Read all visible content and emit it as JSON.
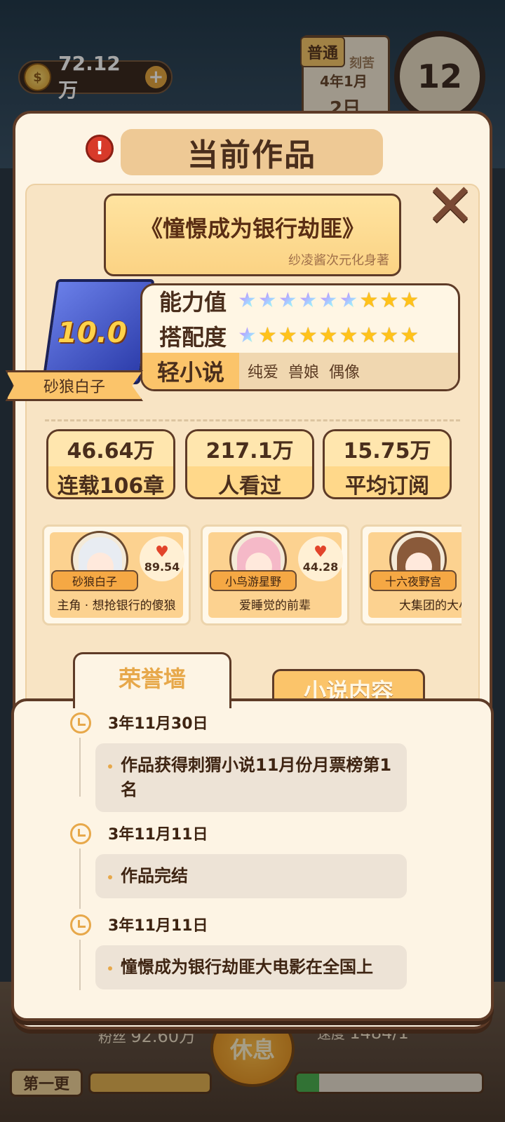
{
  "hud": {
    "coins": "72.12万",
    "coin_glyph": "$",
    "plus": "+",
    "calendar_tag": "普通",
    "calendar_partial": "刻苦",
    "calendar_month": "4年1月",
    "calendar_day": "2日",
    "clock_value": "12",
    "fans_label": "粉丝",
    "fans_value": "92.60万",
    "speed_label": "速度",
    "speed_value": "1484/1",
    "rest_button": "休息",
    "first_update_button": "第一更",
    "progress_b": 0.12
  },
  "dialog": {
    "title": "当前作品",
    "alert_icon": "!",
    "close_icon": "✕",
    "book_title": "《憧憬成为银行劫匪》",
    "book_author": "纱凌酱次元化身著",
    "book_score": "10.0",
    "protagonist": "砂狼白子",
    "ability_label": "能力值",
    "ability_stars": {
      "rainbow": 6,
      "gold": 3
    },
    "match_label": "搭配度",
    "match_stars": {
      "rainbow": 1,
      "gold": 8
    },
    "genre_main": "轻小说",
    "genre_tags": [
      "纯爱",
      "兽娘",
      "偶像"
    ],
    "stats": [
      {
        "value": "46.64万",
        "label": "连载106章"
      },
      {
        "value": "217.1万",
        "label": "人看过"
      },
      {
        "value": "15.75万",
        "label": "平均订阅"
      }
    ],
    "characters": [
      {
        "name": "砂狼白子",
        "affection": "89.54",
        "desc": "主角 · 想抢银行的傻狼",
        "hair": "#e8ecf2"
      },
      {
        "name": "小鸟游星野",
        "affection": "44.28",
        "desc": "爱睡觉的前辈",
        "hair": "#f5b9c8"
      },
      {
        "name": "十六夜野宫",
        "affection": "",
        "desc": "大集团的大小",
        "hair": "#8a5a3a"
      }
    ],
    "tabs": {
      "honor": "荣誉墙",
      "content": "小说内容"
    },
    "timeline": [
      {
        "date": "3年11月30日",
        "text": "作品获得刺猬小说11月份月票榜第1名"
      },
      {
        "date": "3年11月11日",
        "text": "作品完结"
      },
      {
        "date": "3年11月11日",
        "text": "憧憬成为银行劫匪大电影在全国上"
      }
    ]
  }
}
